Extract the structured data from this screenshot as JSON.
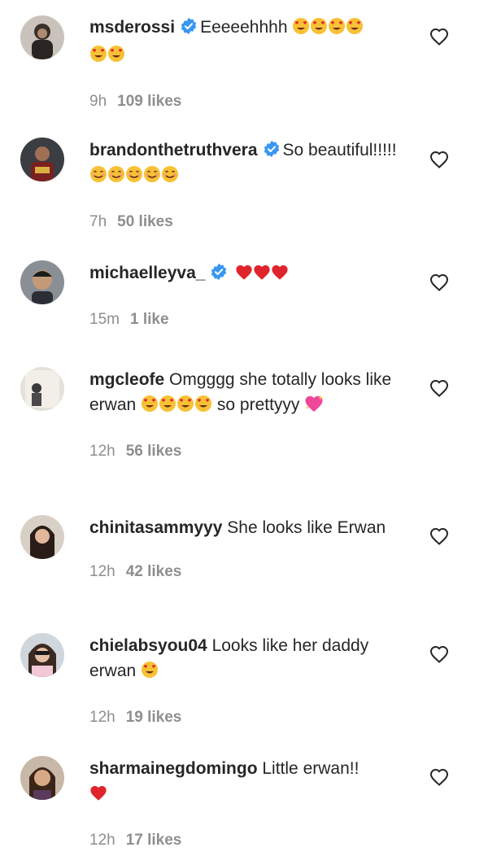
{
  "comments": [
    {
      "username": "msderossi",
      "verified": true,
      "text": "Eeeeehhhh",
      "emojis_inline": [
        "smiling-face-with-heart-eyes",
        "smiling-face-with-heart-eyes",
        "smiling-face-with-heart-eyes",
        "smiling-face-with-heart-eyes"
      ],
      "emojis_line2": [
        "smiling-face-with-heart-eyes",
        "smiling-face-with-heart-eyes"
      ],
      "time": "9h",
      "likes": "109 likes"
    },
    {
      "username": "brandonthetruthvera",
      "verified": true,
      "text": "So beautiful!!!!!",
      "emojis": [
        "smiling-face",
        "smiling-face",
        "smiling-face",
        "smiling-face",
        "smiling-face"
      ],
      "time": "7h",
      "likes": "50 likes"
    },
    {
      "username": "michaelleyva_",
      "verified": true,
      "text": "",
      "emojis": [
        "red-heart",
        "red-heart",
        "red-heart"
      ],
      "time": "15m",
      "likes": "1 like"
    },
    {
      "username": "mgcleofe",
      "verified": false,
      "text": "Omgggg she totally looks like erwan",
      "emojis": [
        "smiling-face-with-heart-eyes",
        "smiling-face-with-heart-eyes",
        "smiling-face-with-heart-eyes",
        "smiling-face-with-heart-eyes"
      ],
      "text_after": "so prettyyy",
      "emoji_end": [
        "sparkling-heart"
      ],
      "time": "12h",
      "likes": "56 likes"
    },
    {
      "username": "chinitasammyyy",
      "verified": false,
      "text": "She looks like Erwan",
      "time": "12h",
      "likes": "42 likes"
    },
    {
      "username": "chielabsyou04",
      "verified": false,
      "text": "Looks like her daddy erwan",
      "emojis": [
        "smiling-face-with-heart-eyes"
      ],
      "time": "12h",
      "likes": "19 likes"
    },
    {
      "username": "sharmainegdomingo",
      "verified": false,
      "text": "Little erwan!!",
      "emojis": [
        "red-heart"
      ],
      "time": "12h",
      "likes": "17 likes"
    }
  ],
  "colors": {
    "verified": "#3897f0",
    "meta": "#8e8e8e",
    "text": "#262626",
    "heart_emoji": "#e0242c",
    "emoji_yellow": "#f7c135"
  }
}
